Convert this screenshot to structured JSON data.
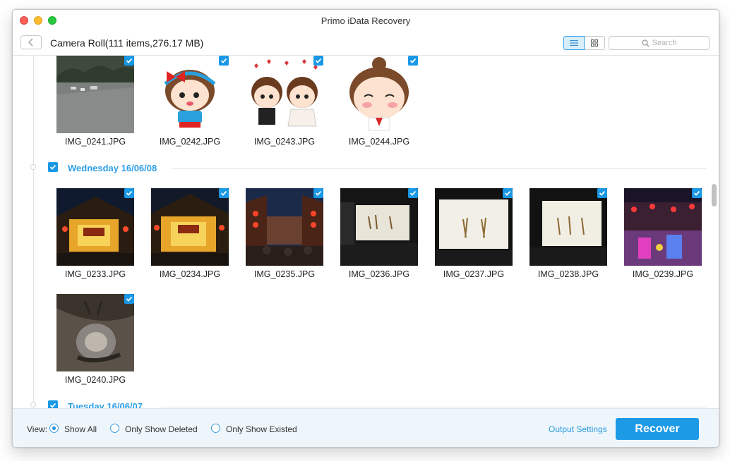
{
  "window": {
    "title": "Primo iData Recovery"
  },
  "toolbar": {
    "folder_title": "Camera Roll(111 items,276.17 MB)",
    "search_placeholder": "Search",
    "active_view": "list"
  },
  "sections": [
    {
      "date": "",
      "photos": [
        "IMG_0241.JPG",
        "IMG_0242.JPG",
        "IMG_0243.JPG",
        "IMG_0244.JPG"
      ]
    },
    {
      "date": "Wednesday 16/06/08",
      "photos": [
        "IMG_0233.JPG",
        "IMG_0234.JPG",
        "IMG_0235.JPG",
        "IMG_0236.JPG",
        "IMG_0237.JPG",
        "IMG_0238.JPG",
        "IMG_0239.JPG",
        "IMG_0240.JPG"
      ]
    },
    {
      "date": "Tuesday 16/06/07",
      "photos": []
    }
  ],
  "footer": {
    "view_label": "View:",
    "options": [
      "Show All",
      "Only Show Deleted",
      "Only Show Existed"
    ],
    "selected_option": "Show All",
    "output_settings": "Output Settings",
    "recover_label": "Recover"
  },
  "colors": {
    "accent": "#1d9ae6",
    "date_header": "#2e9fe6",
    "footer_bg": "#eef6fc"
  }
}
